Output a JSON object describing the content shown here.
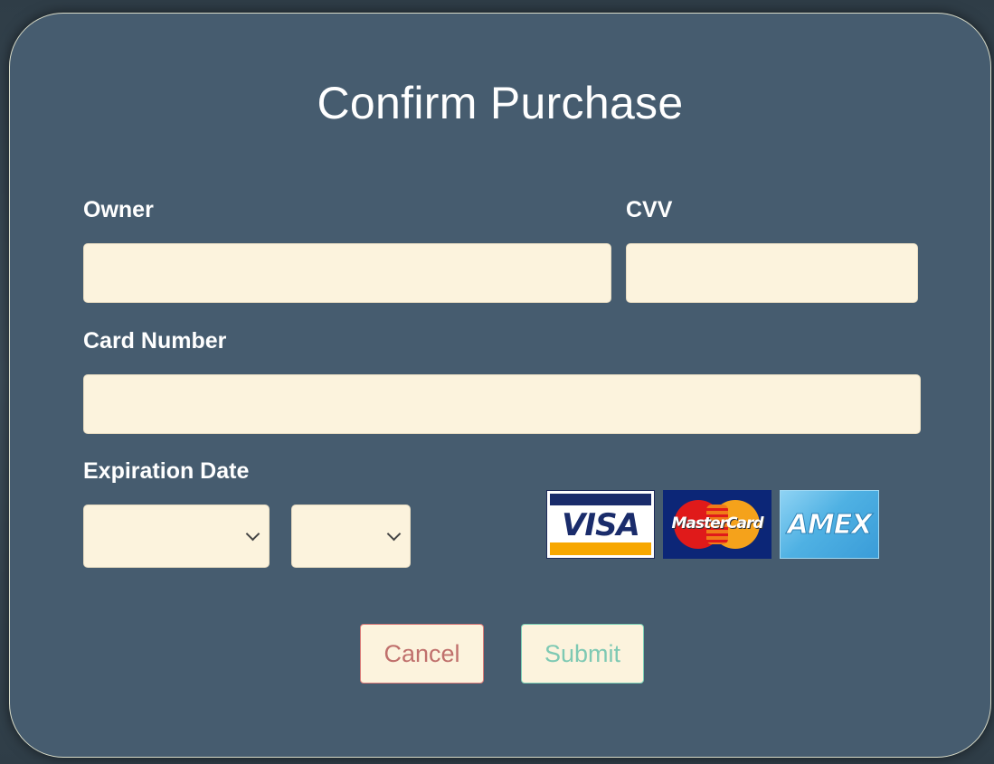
{
  "form": {
    "title": "Confirm Purchase",
    "owner": {
      "label": "Owner",
      "value": ""
    },
    "cvv": {
      "label": "CVV",
      "value": ""
    },
    "card_number": {
      "label": "Card Number",
      "value": ""
    },
    "expiration": {
      "label": "Expiration Date",
      "month_value": "",
      "year_value": ""
    }
  },
  "card_logos": {
    "visa": "VISA",
    "mastercard": "MasterCard",
    "amex": "AMEX"
  },
  "buttons": {
    "cancel": "Cancel",
    "submit": "Submit"
  },
  "colors": {
    "panel_background": "#465c6f",
    "field_background": "#fcf3dd",
    "cancel_accent": "#d97a78",
    "submit_accent": "#7ccfb6"
  },
  "icons": {
    "select_arrow": "chevron-down-icon"
  }
}
